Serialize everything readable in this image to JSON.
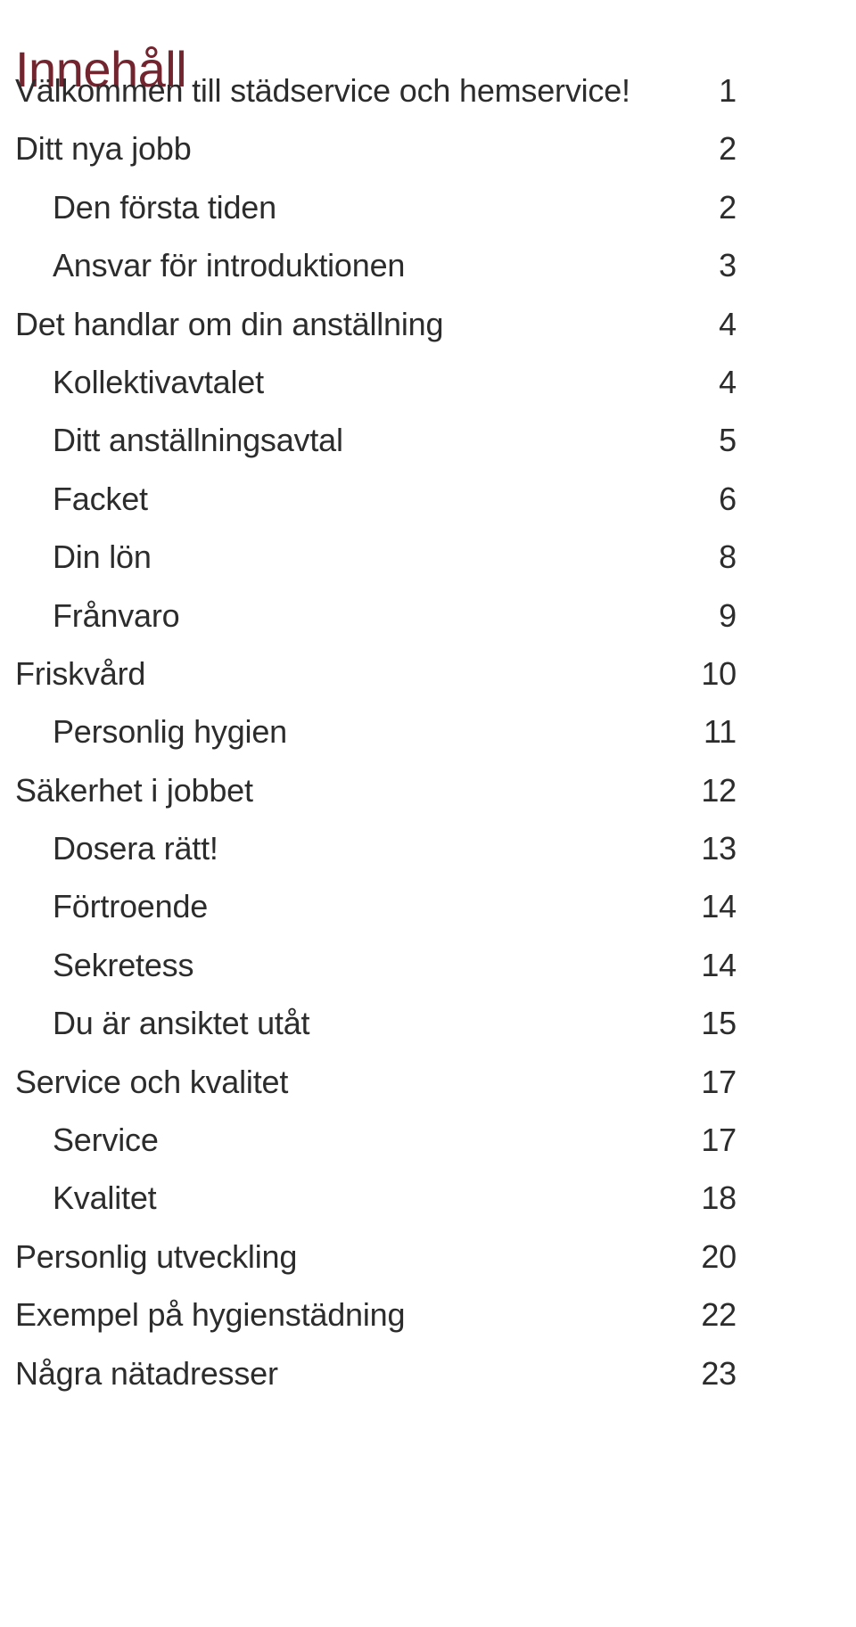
{
  "document": {
    "title": "Innehåll",
    "title_color": "#72252f",
    "text_color": "#2c2c2c",
    "background_color": "#ffffff"
  },
  "toc": {
    "entries": [
      {
        "label": "Välkommen till städservice och hemservice!",
        "page": "1",
        "level": 0
      },
      {
        "label": "Ditt nya jobb",
        "page": "2",
        "level": 0
      },
      {
        "label": "Den första tiden",
        "page": "2",
        "level": 1
      },
      {
        "label": "Ansvar för introduktionen",
        "page": "3",
        "level": 1
      },
      {
        "label": "Det handlar om din anställning",
        "page": "4",
        "level": 0
      },
      {
        "label": "Kollektivavtalet",
        "page": "4",
        "level": 1
      },
      {
        "label": "Ditt anställningsavtal",
        "page": "5",
        "level": 1
      },
      {
        "label": "Facket",
        "page": "6",
        "level": 1
      },
      {
        "label": "Din lön",
        "page": "8",
        "level": 1
      },
      {
        "label": "Frånvaro",
        "page": "9",
        "level": 1
      },
      {
        "label": "Friskvård",
        "page": "10",
        "level": 0
      },
      {
        "label": "Personlig hygien",
        "page": "11",
        "level": 1
      },
      {
        "label": "Säkerhet i jobbet",
        "page": "12",
        "level": 0
      },
      {
        "label": "Dosera rätt!",
        "page": "13",
        "level": 1
      },
      {
        "label": "Förtroende",
        "page": "14",
        "level": 1
      },
      {
        "label": "Sekretess",
        "page": "14",
        "level": 1
      },
      {
        "label": "Du är ansiktet utåt",
        "page": "15",
        "level": 1
      },
      {
        "label": "Service och kvalitet",
        "page": "17",
        "level": 0
      },
      {
        "label": "Service",
        "page": "17",
        "level": 1
      },
      {
        "label": "Kvalitet",
        "page": "18",
        "level": 1
      },
      {
        "label": "Personlig utveckling",
        "page": "20",
        "level": 0
      },
      {
        "label": "Exempel på hygienstädning",
        "page": "22",
        "level": 0
      },
      {
        "label": "Några nätadresser",
        "page": "23",
        "level": 0
      }
    ]
  }
}
